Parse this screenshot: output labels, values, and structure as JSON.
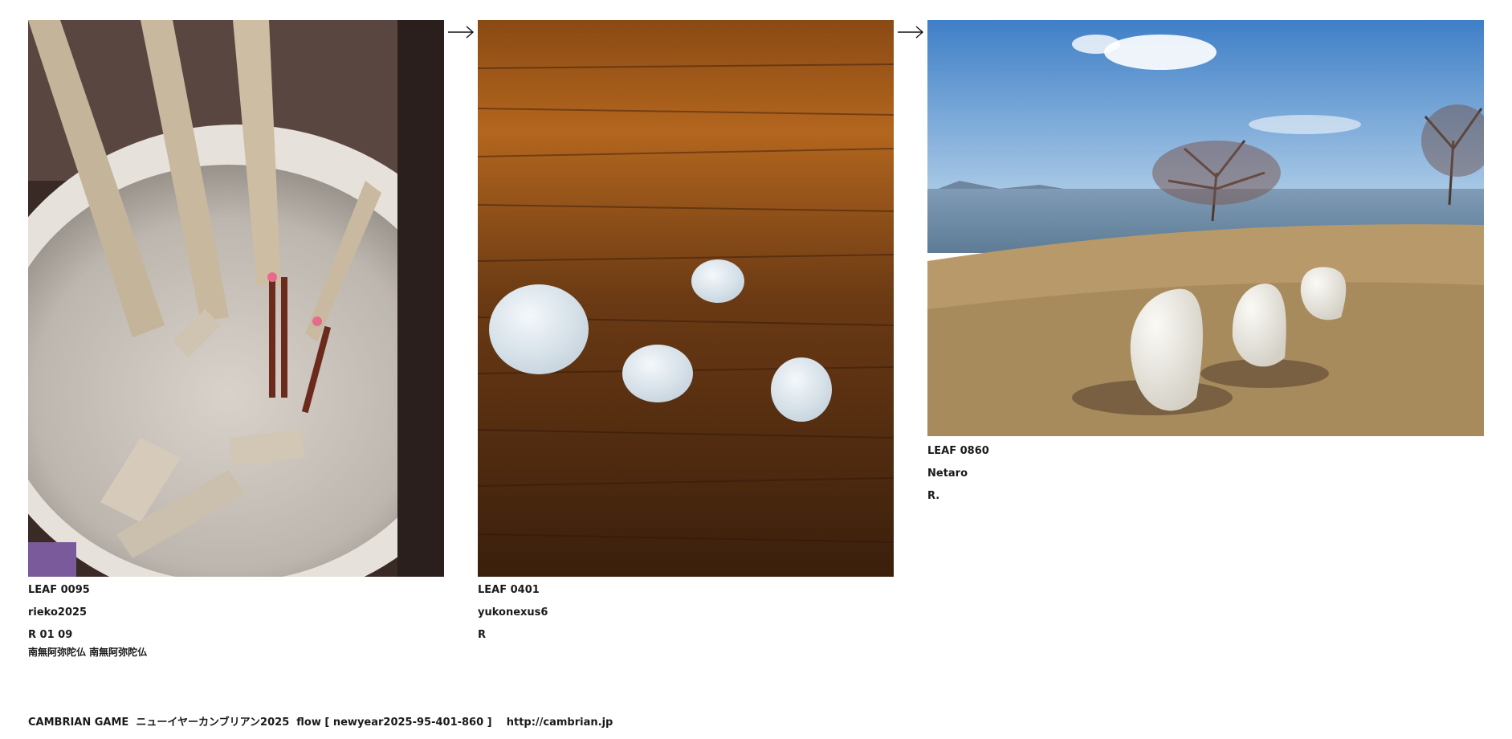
{
  "leaves": [
    {
      "id": "LEAF 0095",
      "author": "rieko2025",
      "ref": "R 01 09",
      "note": "南無阿弥陀仏 南無阿弥陀仏",
      "image_subject": "incense-burner-with-wooden-sotoba"
    },
    {
      "id": "LEAF 0401",
      "author": "yukonexus6",
      "ref": "R",
      "image_subject": "white-pills-on-wood-table"
    },
    {
      "id": "LEAF 0860",
      "author": "Netaro",
      "ref": "R.",
      "image_subject": "white-sculptures-on-lakeside-lawn"
    }
  ],
  "arrow_icon": "right-arrow-icon",
  "footer": {
    "text": "CAMBRIAN GAME  ニューイヤーカンブリアン2025  flow [ newyear2025-95-401-860 ]    http://cambrian.jp"
  }
}
